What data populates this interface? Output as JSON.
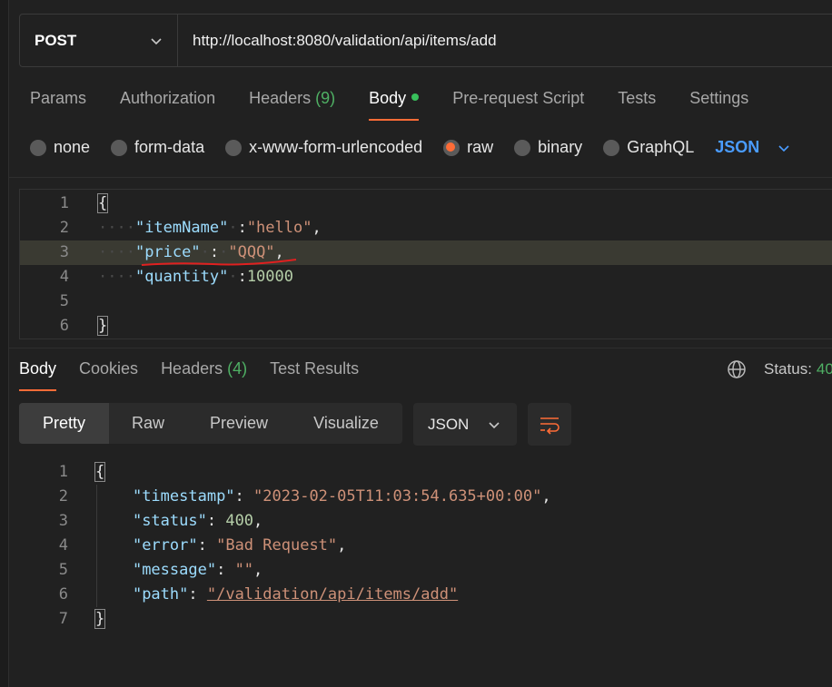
{
  "request": {
    "method": "POST",
    "url": "http://localhost:8080/validation/api/items/add"
  },
  "req_tabs": [
    {
      "label": "Params"
    },
    {
      "label": "Authorization"
    },
    {
      "label": "Headers",
      "count": "(9)"
    },
    {
      "label": "Body"
    },
    {
      "label": "Pre-request Script"
    },
    {
      "label": "Tests"
    },
    {
      "label": "Settings"
    }
  ],
  "body_types": [
    "none",
    "form-data",
    "x-www-form-urlencoded",
    "raw",
    "binary",
    "GraphQL"
  ],
  "body_format": "JSON",
  "editor_lines": {
    "n1": "1",
    "n2": "2",
    "n3": "3",
    "n4": "4",
    "n5": "5",
    "n6": "6",
    "l1": "{",
    "k2": "\"itemName\"",
    "v2": "\"hello\"",
    "k3": "\"price\"",
    "v3": "\"QQQ\"",
    "k4": "\"quantity\"",
    "v4": "10000",
    "l6": "}"
  },
  "response": {
    "tabs": [
      {
        "label": "Body"
      },
      {
        "label": "Cookies"
      },
      {
        "label": "Headers",
        "count": "(4)"
      },
      {
        "label": "Test Results"
      }
    ],
    "status_label": "Status:",
    "status_value": "40",
    "views": [
      "Pretty",
      "Raw",
      "Preview",
      "Visualize"
    ],
    "format": "JSON",
    "lines": {
      "n1": "1",
      "n2": "2",
      "n3": "3",
      "n4": "4",
      "n5": "5",
      "n6": "6",
      "n7": "7",
      "l1": "{",
      "k2": "\"timestamp\"",
      "v2": "\"2023-02-05T11:03:54.635+00:00\"",
      "k3": "\"status\"",
      "v3": "400",
      "k4": "\"error\"",
      "v4": "\"Bad Request\"",
      "k5": "\"message\"",
      "v5": "\"\"",
      "k6": "\"path\"",
      "v6": "\"/validation/api/items/add\"",
      "l7": "}"
    }
  },
  "colors": {
    "accent": "#ff6c37",
    "json_key": "#9cdcfe",
    "json_string": "#ce9178",
    "json_number": "#b5cea8",
    "status_ok": "#4fb064",
    "format_link": "#4a9cff"
  }
}
